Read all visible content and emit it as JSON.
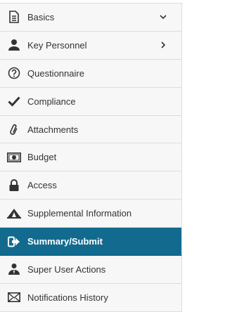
{
  "nav": {
    "items": [
      {
        "label": "Basics",
        "icon": "document-icon",
        "expander": "chevron-down-icon"
      },
      {
        "label": "Key Personnel",
        "icon": "person-icon",
        "expander": "chevron-right-icon"
      },
      {
        "label": "Questionnaire",
        "icon": "question-circle-icon"
      },
      {
        "label": "Compliance",
        "icon": "checkmark-icon"
      },
      {
        "label": "Attachments",
        "icon": "paperclip-icon"
      },
      {
        "label": "Budget",
        "icon": "money-icon"
      },
      {
        "label": "Access",
        "icon": "lock-icon"
      },
      {
        "label": "Supplemental Information",
        "icon": "tent-icon"
      },
      {
        "label": "Summary/Submit",
        "icon": "sign-out-icon",
        "active": true
      },
      {
        "label": "Super User Actions",
        "icon": "user-tie-icon"
      },
      {
        "label": "Notifications History",
        "icon": "envelope-icon"
      }
    ]
  },
  "colors": {
    "active_bg": "#126b8f",
    "item_bg": "#f7f7f7",
    "text": "#333333"
  }
}
